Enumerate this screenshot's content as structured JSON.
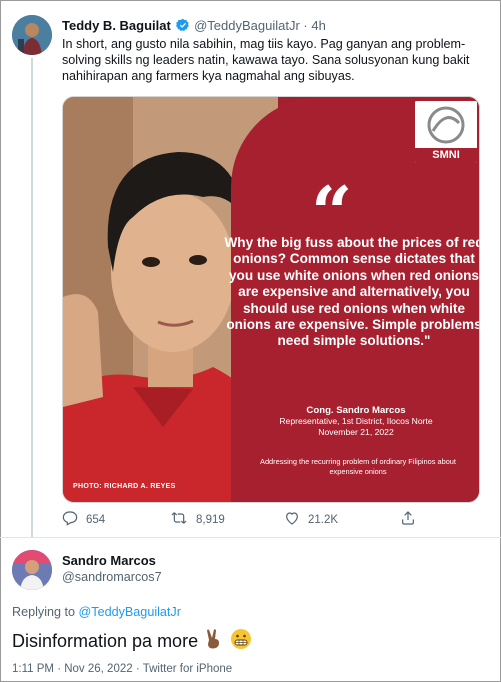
{
  "tweet1": {
    "name": "Teddy B. Baguilat",
    "handle": "@TeddyBaguilatJr",
    "separator": "·",
    "time": "4h",
    "text": "In short, ang gusto nila sabihin, mag tiis kayo. Pag ganyan ang problem-solving skills ng leaders natin, kawawa tayo. Sana solusyonan kung bakit nahihirapan ang farmers kya nagmahal ang sibuyas.",
    "media": {
      "logo": "SMNI",
      "quote_mark": "“",
      "quote": "Why the big fuss about the prices of red onions? Common sense dictates that you use white onions when red onions are expensive and alternatively, you should use red onions when white onions are expensive. Simple problems need simple solutions.\"",
      "attribution_name": "Cong. Sandro Marcos",
      "attribution_title": "Representative, 1st District, Ilocos Norte",
      "attribution_date": "November 21, 2022",
      "note": "Addressing the recurring problem of ordinary Filipinos about  expensive onions",
      "photo_credit": "PHOTO: RICHARD A. REYES"
    },
    "actions": {
      "replies": "654",
      "retweets": "8,919",
      "likes": "21.2K"
    }
  },
  "tweet2": {
    "name": "Sandro Marcos",
    "handle": "@sandromarcos7",
    "replying_prefix": "Replying to",
    "replying_to": "@TeddyBaguilatJr",
    "text": "Disinformation pa more",
    "timestamp": "1:11 PM",
    "separator": "·",
    "date": "Nov 26, 2022",
    "source": "Twitter for iPhone"
  },
  "colors": {
    "accent": "#1d9bf0",
    "media_red": "#a7202f",
    "secondary_text": "#536471"
  },
  "icons": [
    "verified-badge-icon",
    "reply-icon",
    "retweet-icon",
    "like-icon",
    "share-icon",
    "victory-hand-emoji",
    "grimacing-face-emoji"
  ]
}
